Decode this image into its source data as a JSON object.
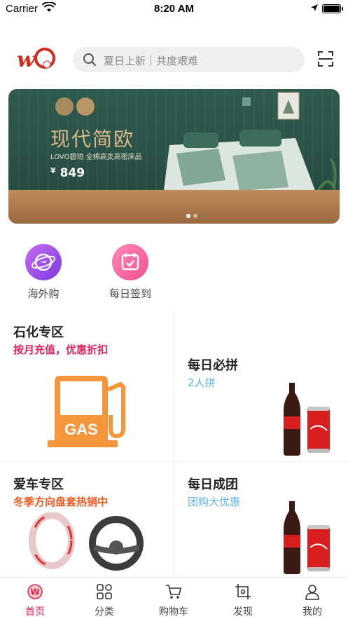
{
  "status_bar": {
    "carrier": "Carrier",
    "time": "8:20 AM"
  },
  "header": {
    "search_placeholder": "夏日上新｜共度艰难"
  },
  "banner": {
    "title": "现代简欧",
    "subtitle": "LOVO碧珀  全棉高支高密床品",
    "price": "849",
    "currency": "¥"
  },
  "quick_links": [
    {
      "label": "海外购",
      "icon": "airplane-globe-icon"
    },
    {
      "label": "每日签到",
      "icon": "calendar-check-icon"
    }
  ],
  "cards": {
    "petro": {
      "title": "石化专区",
      "subtitle": "按月充值，优惠折扣",
      "image_text": "GAS"
    },
    "group_daily": {
      "title": "每日必拼",
      "subtitle": "2人拼"
    },
    "car": {
      "title": "爱车专区",
      "subtitle": "冬季方向盘套热销中"
    },
    "group_deal": {
      "title": "每日成团",
      "subtitle": "团购大优惠"
    }
  },
  "tabbar": {
    "items": [
      {
        "label": "首页",
        "icon": "home-icon",
        "active": true
      },
      {
        "label": "分类",
        "icon": "category-icon",
        "active": false
      },
      {
        "label": "购物车",
        "icon": "cart-icon",
        "active": false
      },
      {
        "label": "发现",
        "icon": "discover-icon",
        "active": false
      },
      {
        "label": "我的",
        "icon": "profile-icon",
        "active": false
      }
    ]
  },
  "colors": {
    "accent": "#e0245e",
    "orange": "#f05a1e",
    "blue": "#5cb4f0",
    "gas_orange": "#f5963c"
  }
}
